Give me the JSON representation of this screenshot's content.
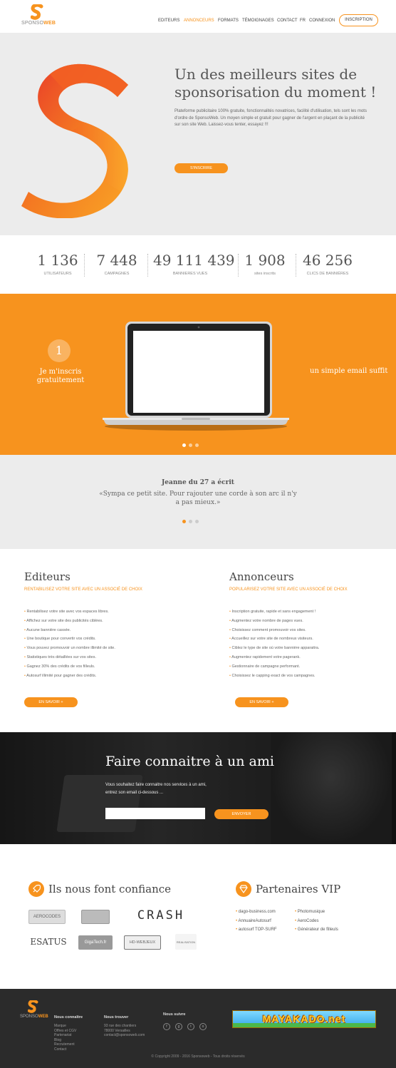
{
  "brand": {
    "logo_text_light": "SPONSO",
    "logo_text_bold": "WEB",
    "accent": "#f7931e"
  },
  "nav": {
    "items": [
      {
        "label": "EDITEURS",
        "active": false
      },
      {
        "label": "ANNONCEURS",
        "active": true
      },
      {
        "label": "FORMATS",
        "active": false
      },
      {
        "label": "TÉMOIGNAGES",
        "active": false
      },
      {
        "label": "CONTACT",
        "active": false
      },
      {
        "label": "FR",
        "active": false
      },
      {
        "label": "CONNEXION",
        "active": false
      }
    ],
    "signup": "INSCRIPTION"
  },
  "hero": {
    "title_line1": "Un des meilleurs sites de",
    "title_line2": "sponsorisation du moment !",
    "text": "Plateforme publicitaire 100% gratuite, fonctionnalités novatrices, facilité d'utilisation, tels sont les mots d'ordre de SponsoWeb. Un moyen simple et gratuit pour gagner de l'argent en plaçant de la publicité sur son site Web. Laissez-vous tenter, essayez !!!",
    "cta": "S'INSCRIRE"
  },
  "stats": [
    {
      "value": "1 136",
      "label": "UTILISATEURS"
    },
    {
      "value": "7 448",
      "label": "CAMPAGNES"
    },
    {
      "value": "49 111 439",
      "label": "BANNIERES VUES"
    },
    {
      "value": "1 908",
      "label": "sites inscrits"
    },
    {
      "value": "46 256",
      "label": "CLICS DE BANNIÈRES"
    }
  ],
  "steps": {
    "number": "1",
    "left_text_line1": "Je m'inscris",
    "left_text_line2": "gratuitement",
    "right_text": "un simple email suffit"
  },
  "testimonial": {
    "author": "Jeanne du 27 a écrit",
    "quote_line1": "«Sympa ce petit site. Pour rajouter une corde à son arc il n'y",
    "quote_line2": "a pas mieux.»"
  },
  "editeurs": {
    "title": "Editeurs",
    "subtitle": "RENTABILISEZ VOTRE SITE AVEC UN ASSOCIÉ DE CHOIX",
    "items": [
      "Rentabilisez votre site avec vos espaces libres.",
      "Affichez sur votre site des publicités ciblées.",
      "Aucune bannière cassée.",
      "Une boutique pour convertir vos crédits.",
      "Vous pouvez promouvoir un nombre illimité de site.",
      "Statistiques très détaillées sur vos sites.",
      "Gagnez 30% des crédits de vos filleuls.",
      "Autosurf illimité pour gagner des crédits."
    ],
    "button": "EN SAVOIR +"
  },
  "annonceurs": {
    "title": "Annonceurs",
    "subtitle": "POPULARISEZ VOTRE SITE AVEC UN ASSOCIÉ DE CHOIX",
    "items": [
      "Inscription gratuite, rapide et sans engagement !",
      "Augmentez votre nombre de pages vues.",
      "Choisissez comment promouvoir vos sites.",
      "Accueillez sur votre site de nombreux visiteurs.",
      "Ciblez le type de site où votre bannière apparaitra.",
      "Augmentez rapidement votre pagerank.",
      "Gestionnaire de campagne performant.",
      "Choisissez le capping exact de vos campagnes."
    ],
    "button": "EN SAVOIR +"
  },
  "refer": {
    "title": "Faire connaitre à un ami",
    "text_line1": "Vous souhaitez faire connaitre nos services à un ami,",
    "text_line2": "entrez son email ci-dessous ...",
    "email_value": "",
    "button": "ENVOYER"
  },
  "trust": {
    "title": "Ils nous font confiance",
    "logos": [
      "AEROCODES",
      "",
      "CRASH",
      "ESATUS",
      "GigaTech.fr",
      "HD-WEBJEUX",
      "REALISATION"
    ]
  },
  "partners": {
    "title": "Partenaires VIP",
    "left": [
      "dago-business.com",
      "AnnuaireAutosurf",
      "autosurf TOP-SURF"
    ],
    "right": [
      "Photomusique",
      "AeroCodes",
      "Générateur de filleuls"
    ]
  },
  "footer": {
    "col1_title": "Nous connaître",
    "col1_items": [
      "Marque",
      "Offres et CGV",
      "Partenariat",
      "Blog",
      "Recrutement",
      "Contact"
    ],
    "col2_title": "Nous trouver",
    "col2_items": [
      "93 rue des chantiers",
      "78000 Versailles",
      "contact@sponsoweb.com"
    ],
    "col3_title": "Nous suivre",
    "banner_text": "MAYAKADO.net",
    "copyright": "© Copyright 2009 - 2016 Sponsoweb - Tous droits réservés"
  }
}
